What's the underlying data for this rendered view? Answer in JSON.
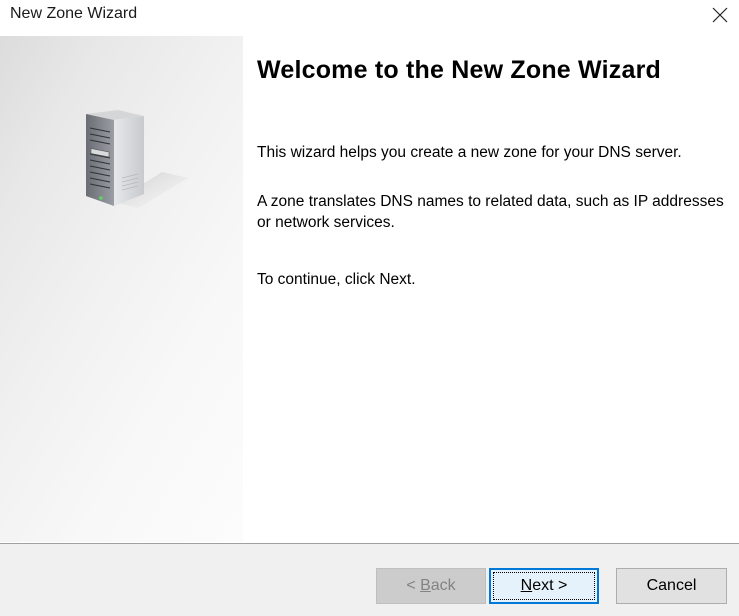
{
  "window": {
    "title": "New Zone Wizard"
  },
  "icons": {
    "close": "close-icon",
    "server": "server-icon"
  },
  "content": {
    "heading": "Welcome to the New Zone Wizard",
    "paragraph1": "This wizard helps you create a new zone for your DNS server.",
    "paragraph2": "A zone translates DNS names to related data, such as IP addresses or network services.",
    "paragraph3": "To continue, click Next."
  },
  "buttons": {
    "back": {
      "prefix": "< ",
      "mnemonic": "B",
      "rest": "ack",
      "enabled": false
    },
    "next": {
      "mnemonic": "N",
      "rest": "ext >",
      "enabled": true,
      "default": true
    },
    "cancel": {
      "label": "Cancel",
      "enabled": true
    }
  },
  "colors": {
    "accent": "#0078d7",
    "footer_bg": "#f0f0f0",
    "disabled_text": "#838383"
  }
}
